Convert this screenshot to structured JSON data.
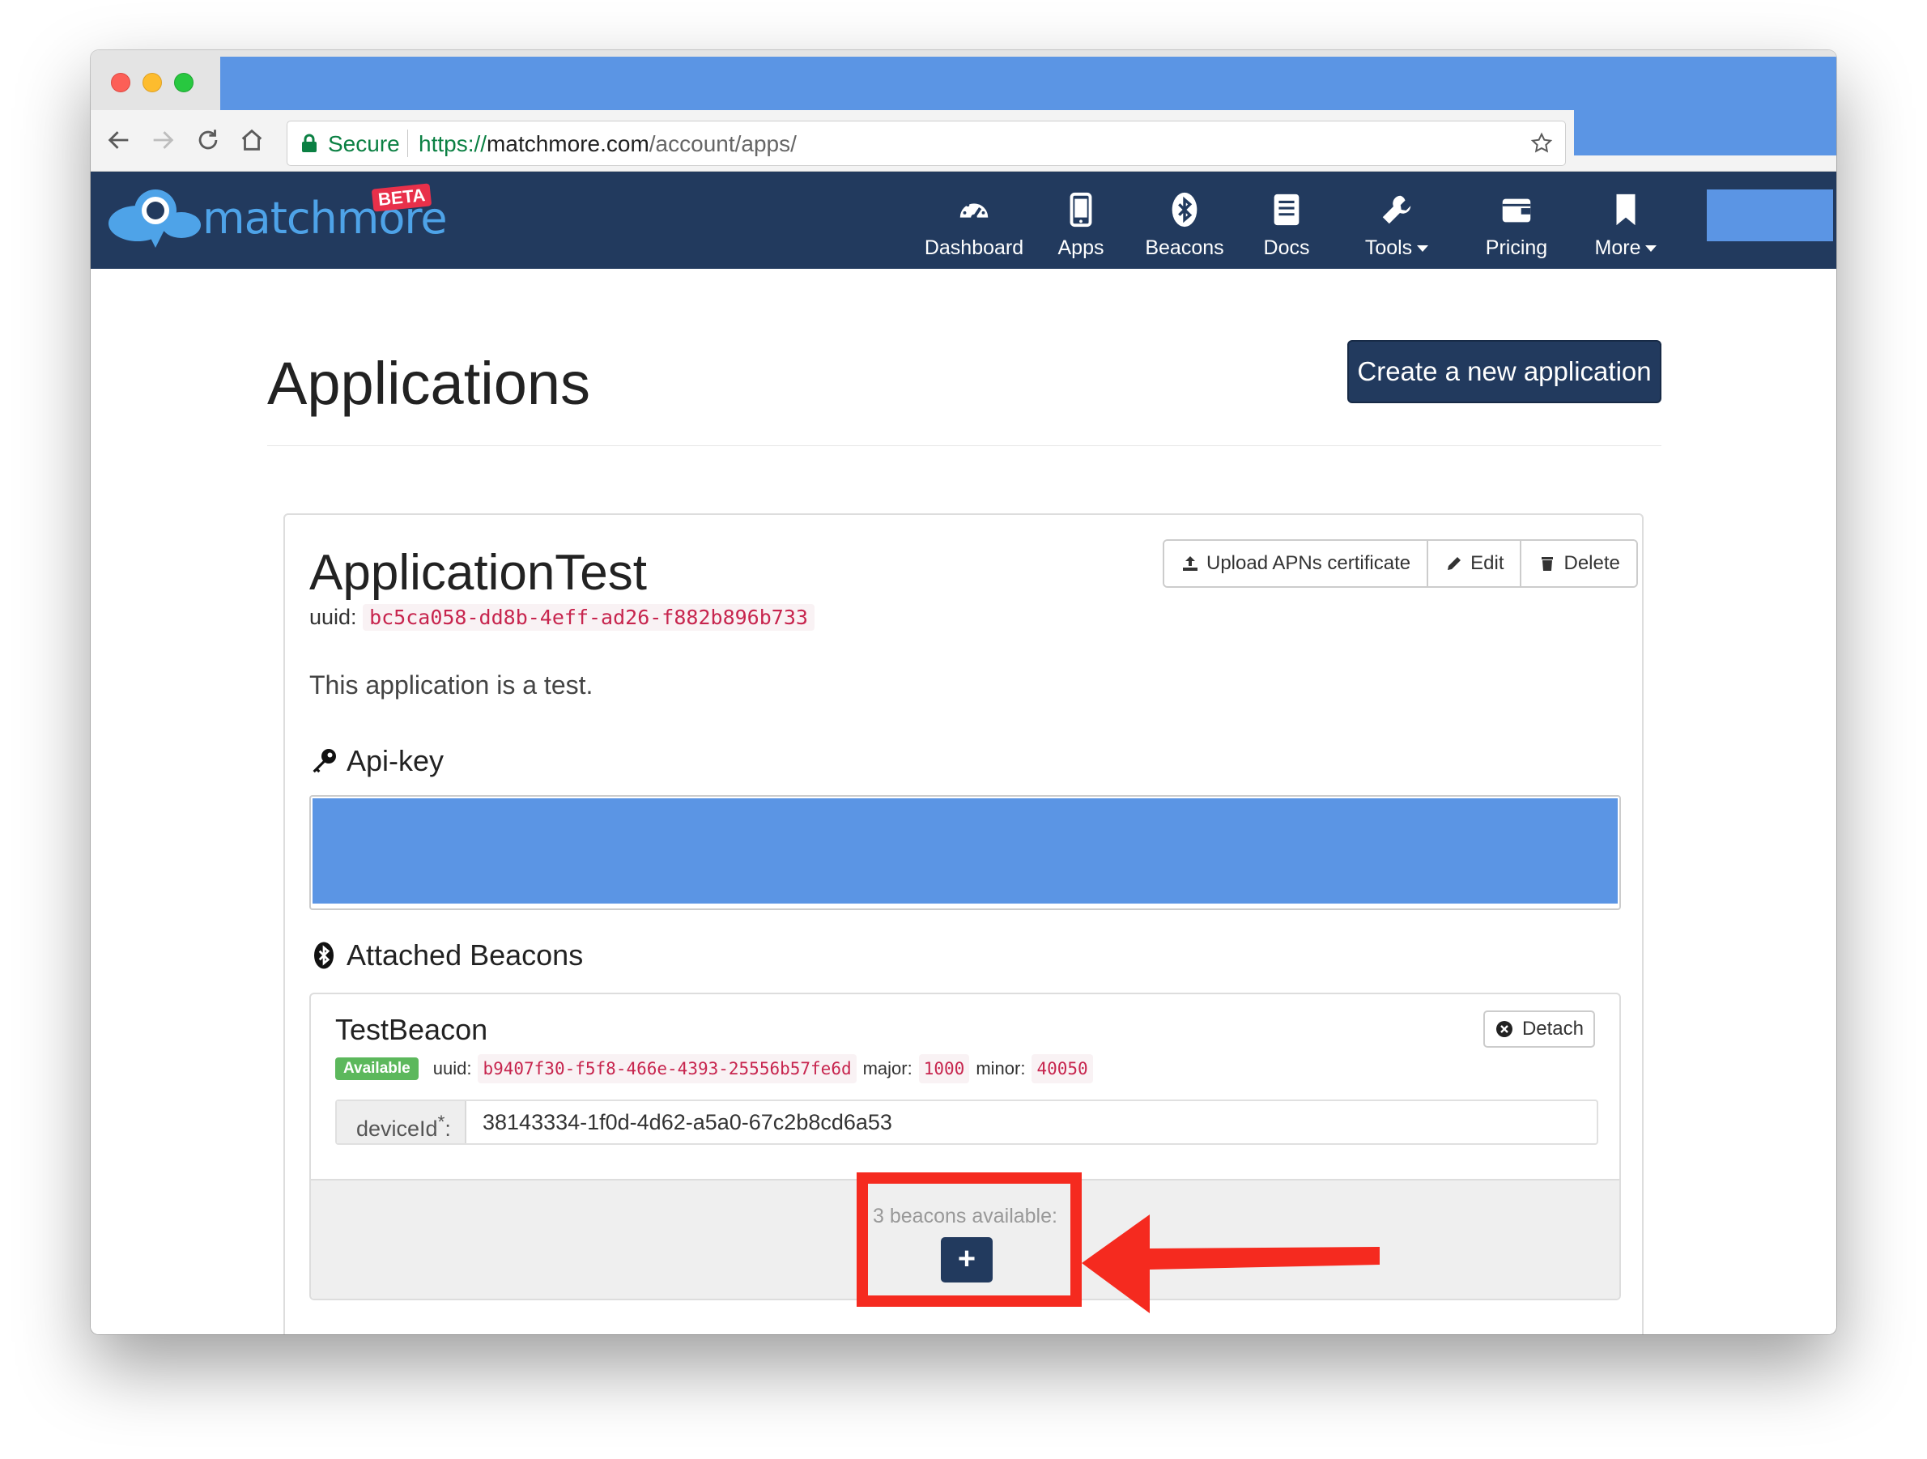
{
  "browser": {
    "secure_label": "Secure",
    "url_proto": "https://",
    "url_host": "matchmore.com",
    "url_path": "/account/apps/"
  },
  "site": {
    "brand": "matchmore",
    "beta": "BETA",
    "nav": [
      {
        "label": "Dashboard",
        "icon": "speedometer-icon"
      },
      {
        "label": "Apps",
        "icon": "mobile-phone-icon"
      },
      {
        "label": "Beacons",
        "icon": "bluetooth-icon"
      },
      {
        "label": "Docs",
        "icon": "book-icon"
      },
      {
        "label": "Tools",
        "icon": "wrench-icon",
        "dropdown": true
      },
      {
        "label": "Pricing",
        "icon": "wallet-icon"
      },
      {
        "label": "More",
        "icon": "bookmark-icon",
        "dropdown": true
      }
    ]
  },
  "page": {
    "title": "Applications",
    "create_button": "Create a new application"
  },
  "app": {
    "name": "ApplicationTest",
    "uuid_label": "uuid:",
    "uuid": "bc5ca058-dd8b-4eff-ad26-f882b896b733",
    "actions": {
      "upload": "Upload APNs certificate",
      "edit": "Edit",
      "delete": "Delete"
    },
    "description": "This application is a test.",
    "api_key_heading": "Api-key",
    "beacons_heading": "Attached Beacons"
  },
  "beacon": {
    "name": "TestBeacon",
    "status": "Available",
    "uuid_label": "uuid:",
    "uuid": "b9407f30-f5f8-466e-4393-25556b57fe6d",
    "major_label": "major:",
    "major": "1000",
    "minor_label": "minor:",
    "minor": "40050",
    "detach_label": "Detach",
    "device_label": "deviceId",
    "device_required_mark": "*",
    "device_colon": ":",
    "device_id": "38143334-1f0d-4d62-a5a0-67c2b8cd6a53"
  },
  "beacons_footer": {
    "available_text": "3 beacons available:",
    "add_label": "+"
  },
  "colors": {
    "navy": "#223a5e",
    "brand_blue": "#4ea3e8",
    "redaction": "#5b95e4",
    "annotation_red": "#f52a1f",
    "available_green": "#5cb85c"
  }
}
